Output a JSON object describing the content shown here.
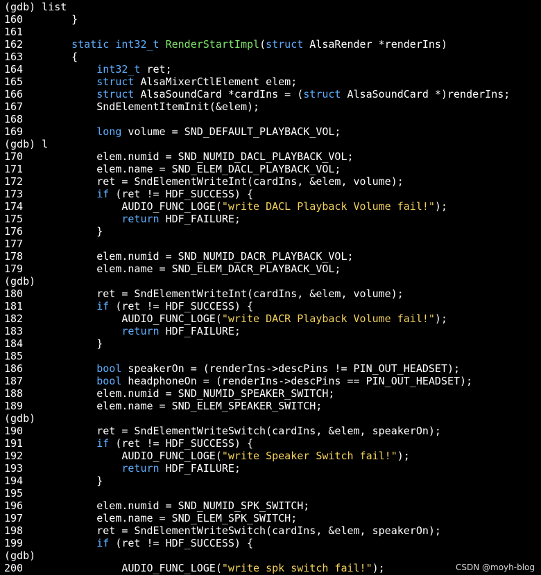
{
  "colors": {
    "background": "#000000",
    "text": "#ffffff",
    "keyword": "#5fafff",
    "function": "#7fe36a",
    "string": "#f2d25a"
  },
  "lines": [
    {
      "kind": "gdb",
      "segments": [
        {
          "t": "(gdb) list",
          "c": "n"
        }
      ]
    },
    {
      "kind": "code",
      "num": "160",
      "segments": [
        {
          "t": "    }",
          "c": "n"
        }
      ]
    },
    {
      "kind": "code",
      "num": "161",
      "segments": [
        {
          "t": "",
          "c": "n"
        }
      ]
    },
    {
      "kind": "code",
      "num": "162",
      "segments": [
        {
          "t": "    ",
          "c": "n"
        },
        {
          "t": "static",
          "c": "kw"
        },
        {
          "t": " ",
          "c": "n"
        },
        {
          "t": "int32_t",
          "c": "kw"
        },
        {
          "t": " ",
          "c": "n"
        },
        {
          "t": "RenderStartImpl",
          "c": "fn"
        },
        {
          "t": "(",
          "c": "n"
        },
        {
          "t": "struct",
          "c": "kw"
        },
        {
          "t": " AlsaRender *renderIns)",
          "c": "n"
        }
      ]
    },
    {
      "kind": "code",
      "num": "163",
      "segments": [
        {
          "t": "    {",
          "c": "n"
        }
      ]
    },
    {
      "kind": "code",
      "num": "164",
      "segments": [
        {
          "t": "        ",
          "c": "n"
        },
        {
          "t": "int32_t",
          "c": "kw"
        },
        {
          "t": " ret;",
          "c": "n"
        }
      ]
    },
    {
      "kind": "code",
      "num": "165",
      "segments": [
        {
          "t": "        ",
          "c": "n"
        },
        {
          "t": "struct",
          "c": "kw"
        },
        {
          "t": " AlsaMixerCtlElement elem;",
          "c": "n"
        }
      ]
    },
    {
      "kind": "code",
      "num": "166",
      "segments": [
        {
          "t": "        ",
          "c": "n"
        },
        {
          "t": "struct",
          "c": "kw"
        },
        {
          "t": " AlsaSoundCard *cardIns = (",
          "c": "n"
        },
        {
          "t": "struct",
          "c": "kw"
        },
        {
          "t": " AlsaSoundCard *)renderIns;",
          "c": "n"
        }
      ]
    },
    {
      "kind": "code",
      "num": "167",
      "segments": [
        {
          "t": "        SndElementItemInit(&elem);",
          "c": "n"
        }
      ]
    },
    {
      "kind": "code",
      "num": "168",
      "segments": [
        {
          "t": "",
          "c": "n"
        }
      ]
    },
    {
      "kind": "code",
      "num": "169",
      "segments": [
        {
          "t": "        ",
          "c": "n"
        },
        {
          "t": "long",
          "c": "kw"
        },
        {
          "t": " volume = SND_DEFAULT_PLAYBACK_VOL;",
          "c": "n"
        }
      ]
    },
    {
      "kind": "gdb",
      "segments": [
        {
          "t": "(gdb) l",
          "c": "n"
        }
      ]
    },
    {
      "kind": "code",
      "num": "170",
      "segments": [
        {
          "t": "        elem.numid = SND_NUMID_DACL_PLAYBACK_VOL;",
          "c": "n"
        }
      ]
    },
    {
      "kind": "code",
      "num": "171",
      "segments": [
        {
          "t": "        elem.name = SND_ELEM_DACL_PLAYBACK_VOL;",
          "c": "n"
        }
      ]
    },
    {
      "kind": "code",
      "num": "172",
      "segments": [
        {
          "t": "        ret = SndElementWriteInt(cardIns, &elem, volume);",
          "c": "n"
        }
      ]
    },
    {
      "kind": "code",
      "num": "173",
      "segments": [
        {
          "t": "        ",
          "c": "n"
        },
        {
          "t": "if",
          "c": "kw"
        },
        {
          "t": " (ret != HDF_SUCCESS) {",
          "c": "n"
        }
      ]
    },
    {
      "kind": "code",
      "num": "174",
      "segments": [
        {
          "t": "            AUDIO_FUNC_LOGE(",
          "c": "n"
        },
        {
          "t": "\"write DACL Playback Volume fail!\"",
          "c": "str"
        },
        {
          "t": ");",
          "c": "n"
        }
      ]
    },
    {
      "kind": "code",
      "num": "175",
      "segments": [
        {
          "t": "            ",
          "c": "n"
        },
        {
          "t": "return",
          "c": "kw"
        },
        {
          "t": " HDF_FAILURE;",
          "c": "n"
        }
      ]
    },
    {
      "kind": "code",
      "num": "176",
      "segments": [
        {
          "t": "        }",
          "c": "n"
        }
      ]
    },
    {
      "kind": "code",
      "num": "177",
      "segments": [
        {
          "t": "",
          "c": "n"
        }
      ]
    },
    {
      "kind": "code",
      "num": "178",
      "segments": [
        {
          "t": "        elem.numid = SND_NUMID_DACR_PLAYBACK_VOL;",
          "c": "n"
        }
      ]
    },
    {
      "kind": "code",
      "num": "179",
      "segments": [
        {
          "t": "        elem.name = SND_ELEM_DACR_PLAYBACK_VOL;",
          "c": "n"
        }
      ]
    },
    {
      "kind": "gdb",
      "segments": [
        {
          "t": "(gdb)",
          "c": "n"
        }
      ]
    },
    {
      "kind": "code",
      "num": "180",
      "segments": [
        {
          "t": "        ret = SndElementWriteInt(cardIns, &elem, volume);",
          "c": "n"
        }
      ]
    },
    {
      "kind": "code",
      "num": "181",
      "segments": [
        {
          "t": "        ",
          "c": "n"
        },
        {
          "t": "if",
          "c": "kw"
        },
        {
          "t": " (ret != HDF_SUCCESS) {",
          "c": "n"
        }
      ]
    },
    {
      "kind": "code",
      "num": "182",
      "segments": [
        {
          "t": "            AUDIO_FUNC_LOGE(",
          "c": "n"
        },
        {
          "t": "\"write DACR Playback Volume fail!\"",
          "c": "str"
        },
        {
          "t": ");",
          "c": "n"
        }
      ]
    },
    {
      "kind": "code",
      "num": "183",
      "segments": [
        {
          "t": "            ",
          "c": "n"
        },
        {
          "t": "return",
          "c": "kw"
        },
        {
          "t": " HDF_FAILURE;",
          "c": "n"
        }
      ]
    },
    {
      "kind": "code",
      "num": "184",
      "segments": [
        {
          "t": "        }",
          "c": "n"
        }
      ]
    },
    {
      "kind": "code",
      "num": "185",
      "segments": [
        {
          "t": "",
          "c": "n"
        }
      ]
    },
    {
      "kind": "code",
      "num": "186",
      "segments": [
        {
          "t": "        ",
          "c": "n"
        },
        {
          "t": "bool",
          "c": "kw"
        },
        {
          "t": " speakerOn = (renderIns->descPins != PIN_OUT_HEADSET);",
          "c": "n"
        }
      ]
    },
    {
      "kind": "code",
      "num": "187",
      "segments": [
        {
          "t": "        ",
          "c": "n"
        },
        {
          "t": "bool",
          "c": "kw"
        },
        {
          "t": " headphoneOn = (renderIns->descPins == PIN_OUT_HEADSET);",
          "c": "n"
        }
      ]
    },
    {
      "kind": "code",
      "num": "188",
      "segments": [
        {
          "t": "        elem.numid = SND_NUMID_SPEAKER_SWITCH;",
          "c": "n"
        }
      ]
    },
    {
      "kind": "code",
      "num": "189",
      "segments": [
        {
          "t": "        elem.name = SND_ELEM_SPEAKER_SWITCH;",
          "c": "n"
        }
      ]
    },
    {
      "kind": "gdb",
      "segments": [
        {
          "t": "(gdb)",
          "c": "n"
        }
      ]
    },
    {
      "kind": "code",
      "num": "190",
      "segments": [
        {
          "t": "        ret = SndElementWriteSwitch(cardIns, &elem, speakerOn);",
          "c": "n"
        }
      ]
    },
    {
      "kind": "code",
      "num": "191",
      "segments": [
        {
          "t": "        ",
          "c": "n"
        },
        {
          "t": "if",
          "c": "kw"
        },
        {
          "t": " (ret != HDF_SUCCESS) {",
          "c": "n"
        }
      ]
    },
    {
      "kind": "code",
      "num": "192",
      "segments": [
        {
          "t": "            AUDIO_FUNC_LOGE(",
          "c": "n"
        },
        {
          "t": "\"write Speaker Switch fail!\"",
          "c": "str"
        },
        {
          "t": ");",
          "c": "n"
        }
      ]
    },
    {
      "kind": "code",
      "num": "193",
      "segments": [
        {
          "t": "            ",
          "c": "n"
        },
        {
          "t": "return",
          "c": "kw"
        },
        {
          "t": " HDF_FAILURE;",
          "c": "n"
        }
      ]
    },
    {
      "kind": "code",
      "num": "194",
      "segments": [
        {
          "t": "        }",
          "c": "n"
        }
      ]
    },
    {
      "kind": "code",
      "num": "195",
      "segments": [
        {
          "t": "",
          "c": "n"
        }
      ]
    },
    {
      "kind": "code",
      "num": "196",
      "segments": [
        {
          "t": "        elem.numid = SND_NUMID_SPK_SWITCH;",
          "c": "n"
        }
      ]
    },
    {
      "kind": "code",
      "num": "197",
      "segments": [
        {
          "t": "        elem.name = SND_ELEM_SPK_SWITCH;",
          "c": "n"
        }
      ]
    },
    {
      "kind": "code",
      "num": "198",
      "segments": [
        {
          "t": "        ret = SndElementWriteSwitch(cardIns, &elem, speakerOn);",
          "c": "n"
        }
      ]
    },
    {
      "kind": "code",
      "num": "199",
      "segments": [
        {
          "t": "        ",
          "c": "n"
        },
        {
          "t": "if",
          "c": "kw"
        },
        {
          "t": " (ret != HDF_SUCCESS) {",
          "c": "n"
        }
      ]
    },
    {
      "kind": "gdb",
      "segments": [
        {
          "t": "(gdb)",
          "c": "n"
        }
      ]
    },
    {
      "kind": "code",
      "num": "200",
      "segments": [
        {
          "t": "            AUDIO_FUNC_LOGE(",
          "c": "n"
        },
        {
          "t": "\"write spk switch fail!\"",
          "c": "str"
        },
        {
          "t": ");",
          "c": "n"
        }
      ]
    }
  ],
  "watermark": "CSDN @moyh-blog"
}
